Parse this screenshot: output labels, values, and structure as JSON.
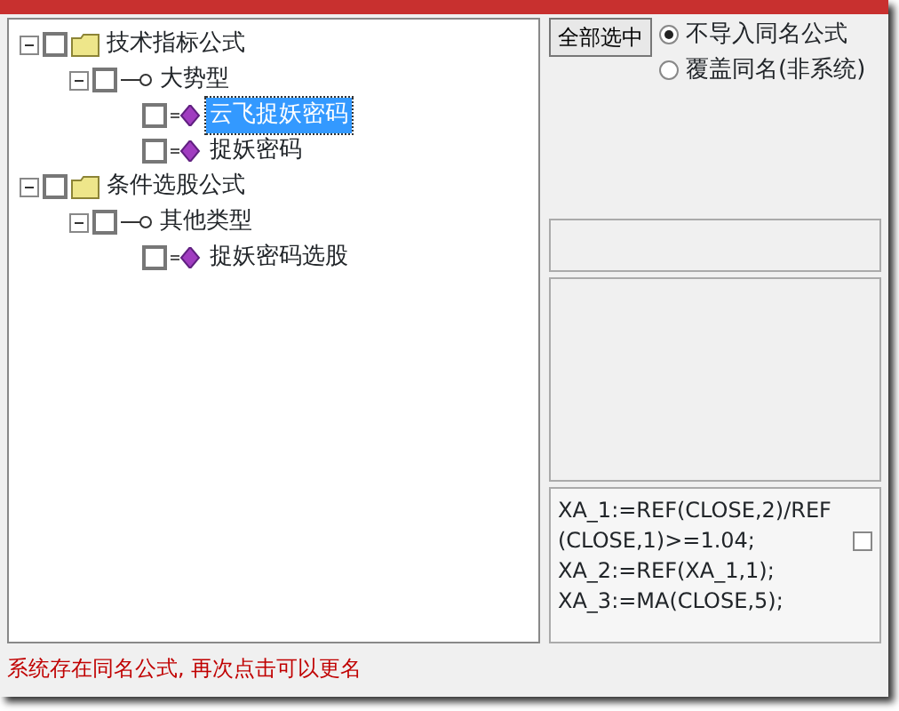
{
  "tree": [
    {
      "label": "技术指标公式",
      "kind": "folder",
      "checked": false,
      "expanded": true,
      "selected": false,
      "children": [
        {
          "label": "大势型",
          "kind": "group",
          "checked": false,
          "expanded": true,
          "selected": false,
          "children": [
            {
              "label": "云飞捉妖密码",
              "kind": "formula",
              "checked": false,
              "selected": true
            },
            {
              "label": "捉妖密码",
              "kind": "formula",
              "checked": false,
              "selected": false
            }
          ]
        }
      ]
    },
    {
      "label": "条件选股公式",
      "kind": "folder",
      "checked": false,
      "expanded": true,
      "selected": false,
      "children": [
        {
          "label": "其他类型",
          "kind": "group",
          "checked": false,
          "expanded": true,
          "selected": false,
          "children": [
            {
              "label": "捉妖密码选股",
              "kind": "formula",
              "checked": false,
              "selected": false
            }
          ]
        }
      ]
    }
  ],
  "select_all_button": "全部选中",
  "options": [
    {
      "label": "不导入同名公式",
      "selected": true
    },
    {
      "label": "覆盖同名(非系统)",
      "selected": false
    }
  ],
  "code": {
    "lines": [
      "XA_1:=REF(CLOSE,2)/REF",
      "(CLOSE,1)>=1.04;",
      "XA_2:=REF(XA_1,1);",
      "XA_3:=MA(CLOSE,5);"
    ],
    "checked": false
  },
  "status": "系统存在同名公式, 再次点击可以更名"
}
